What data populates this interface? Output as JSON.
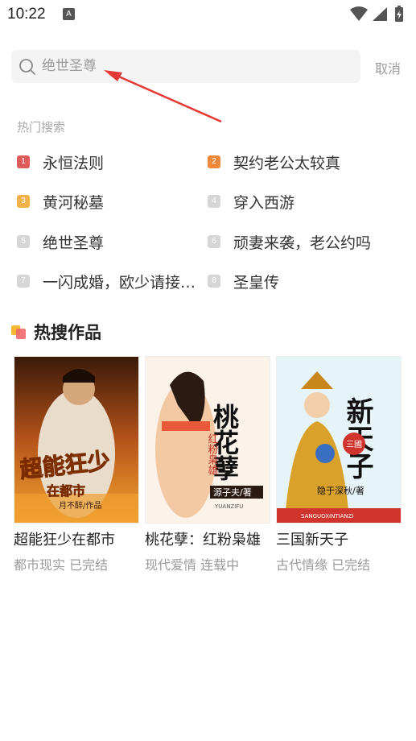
{
  "status_bar": {
    "time": "10:22",
    "notification_badge": "A",
    "icons": [
      "wifi-icon",
      "cellular-icon",
      "battery-icon"
    ]
  },
  "search": {
    "placeholder": "绝世圣尊",
    "cancel_label": "取消"
  },
  "hot_search": {
    "title": "热门搜索",
    "items": [
      {
        "rank": "1",
        "label": "永恒法则",
        "color": "#e05a5a"
      },
      {
        "rank": "2",
        "label": "契约老公太较真",
        "color": "#f0883a"
      },
      {
        "rank": "3",
        "label": "黄河秘墓",
        "color": "#f2b24a"
      },
      {
        "rank": "4",
        "label": "穿入西游",
        "color": "#d6d6d6"
      },
      {
        "rank": "5",
        "label": "绝世圣尊",
        "color": "#d6d6d6"
      },
      {
        "rank": "6",
        "label": "顽妻来袭，老公约吗",
        "color": "#d6d6d6"
      },
      {
        "rank": "7",
        "label": "一闪成婚，欧少请接…",
        "color": "#d6d6d6"
      },
      {
        "rank": "8",
        "label": "圣皇传",
        "color": "#d6d6d6"
      }
    ]
  },
  "hot_works": {
    "title": "热搜作品",
    "books": [
      {
        "title": "超能狂少在都市",
        "meta": "都市现实 已完结",
        "cover_title": "超能狂少",
        "cover_subtitle": "在都市",
        "cover_author": "月不醉/作品"
      },
      {
        "title": "桃花孽：红粉枭雄",
        "meta": "现代爱情 连载中",
        "cover_title": "桃花孽",
        "cover_subtitle": "红粉枭雄",
        "cover_author": "源子夫/著",
        "cover_pinyin": "YUANZIFU"
      },
      {
        "title": "三国新天子",
        "meta": "古代情缘 已完结",
        "cover_title": "新天子",
        "cover_subtitle": "三國",
        "cover_author": "隐于深秋/著",
        "cover_pinyin": "SANGUOXINTIANZI"
      }
    ]
  },
  "colors": {
    "accent_red": "#e53935",
    "muted_text": "#9a9a9a",
    "search_bg": "#f4f4f4"
  }
}
